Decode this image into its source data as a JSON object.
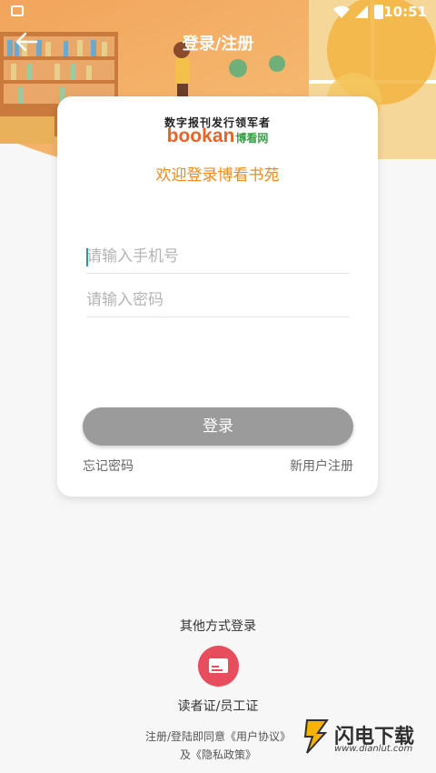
{
  "status_bar": {
    "time": "10:51"
  },
  "app_bar": {
    "title": "登录/注册"
  },
  "card": {
    "slogan": "数字报刊发行领军者",
    "brand": "bookan",
    "brand_cn": "博看网",
    "welcome": "欢迎登录博看书苑",
    "phone_placeholder": "请输入手机号",
    "password_placeholder": "请输入密码",
    "login_label": "登录",
    "forgot_label": "忘记密码",
    "register_label": "新用户注册"
  },
  "other": {
    "title": "其他方式登录",
    "card_login_label": "读者证/员工证"
  },
  "agreement": {
    "line1": "注册/登陆即同意《用户协议》",
    "line2": "及《隐私政策》"
  },
  "watermark": {
    "text": "闪电下载",
    "url": "www.dianlut.com"
  },
  "colors": {
    "accent_orange": "#f08a1c",
    "brand_orange": "#e5642a",
    "icon_red": "#e84d5d",
    "button_gray": "#9b9b9b"
  }
}
